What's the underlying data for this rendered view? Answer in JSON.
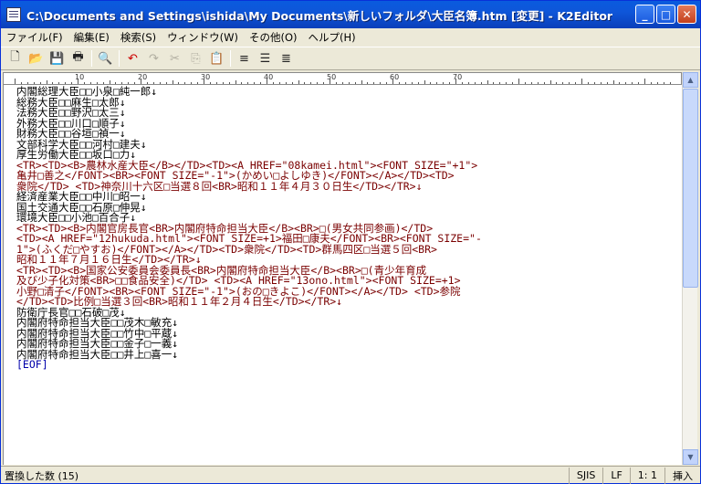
{
  "window": {
    "title": "C:\\Documents and Settings\\ishida\\My Documents\\新しいフォルダ\\大臣名簿.htm [変更] - K2Editor",
    "minimize": "_",
    "maximize": "□",
    "close": "✕"
  },
  "menu": [
    "ファイル(F)",
    "編集(E)",
    "検索(S)",
    "ウィンドウ(W)",
    "その他(O)",
    "ヘルプ(H)"
  ],
  "toolbar": {
    "new": "new-file-icon",
    "open": "open-folder-icon",
    "save": "save-icon",
    "print": "print-icon",
    "find": "search-icon",
    "undo": "undo-icon",
    "redo": "redo-icon",
    "cut": "cut-icon",
    "copy": "copy-icon",
    "paste": "paste-icon",
    "align_left": "align-left-icon",
    "align_center": "align-center-icon",
    "align_right": "align-right-icon"
  },
  "ruler": [
    "10",
    "20",
    "30",
    "40",
    "50",
    "60",
    "70"
  ],
  "lines": [
    "内閣総理大臣□□小泉□純一郎↓",
    "総務大臣□□麻生□太郎↓",
    "法務大臣□□野沢□太三↓",
    "外務大臣□□川口□順子↓",
    "財務大臣□□谷垣□禎一↓",
    "文部科学大臣□□河村□建夫↓",
    "厚生労働大臣□□坂口□力↓",
    "<TR><TD><B>農林水産大臣</B></TD><TD><A HREF=\"08kamei.html\"><FONT SIZE=\"+1\">",
    "亀井□善之</FONT><BR><FONT SIZE=\"-1\">(かめい□よしゆき)</FONT></A></TD><TD>",
    "衆院</TD> <TD>神奈川十六区□当選８回<BR>昭和１１年４月３０日生</TD></TR>↓",
    "経済産業大臣□□中川□昭一↓",
    "国土交通大臣□□石原□伸晃↓",
    "環境大臣□□小池□百合子↓",
    "<TR><TD><B>内閣官房長官<BR>内閣府特命担当大臣</B><BR>□(男女共同参画)</TD>",
    "<TD><A HREF=\"12hukuda.html\"><FONT SIZE=+1>福田□康夫</FONT><BR><FONT SIZE=\"-",
    "1\">(ふくだ□やすお)</FONT></A></TD><TD>衆院</TD><TD>群馬四区□当選５回<BR>",
    "昭和１１年７月１６日生</TD></TR>↓",
    "<TR><TD><B>国家公安委員会委員長<BR>内閣府特命担当大臣</B><BR>□(青少年育成",
    "及び少子化対策<BR>□□食品安全)</TD> <TD><A HREF=\"13ono.html\"><FONT SIZE=+1>",
    "小野□清子</FONT><BR><FONT SIZE=\"-1\">(おの□きよこ)</FONT></A></TD> <TD>参院",
    "</TD><TD>比例□当選３回<BR>昭和１１年２月４日生</TD></TR>↓",
    "防衛庁長官□□石破□茂↓",
    "内閣府特命担当大臣□□茂木□敏充↓",
    "内閣府特命担当大臣□□竹中□平蔵↓",
    "内閣府特命担当大臣□□金子□一義↓",
    "内閣府特命担当大臣□□井上□喜一↓",
    "[EOF]"
  ],
  "status": {
    "message": "置換した数 (15)",
    "encoding": "SJIS",
    "newline": "LF",
    "position": "1: 1",
    "mode": "挿入"
  }
}
